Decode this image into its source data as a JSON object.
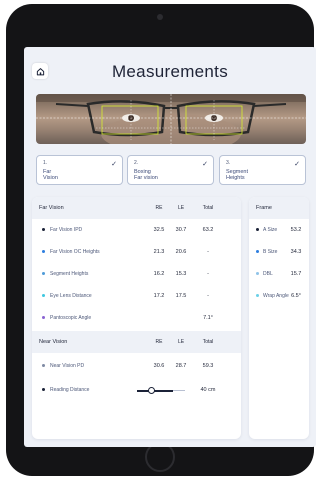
{
  "header": {
    "title": "Measurements",
    "home_icon": "home-icon"
  },
  "steps": [
    {
      "number": "1.",
      "label": "Far\nVision",
      "completed": true
    },
    {
      "number": "2.",
      "label": "Boxing\nFar vision",
      "completed": true
    },
    {
      "number": "3.",
      "label": "Segment\nHeights",
      "completed": true
    }
  ],
  "far_vision": {
    "title": "Far Vision",
    "columns": {
      "re": "RE",
      "le": "LE",
      "total": "Total"
    },
    "rows": [
      {
        "label": "Far Vision IPD",
        "re": "32.5",
        "le": "30.7",
        "total": "63.2",
        "color": "#1b2238"
      },
      {
        "label": "Far Vision OC Heights",
        "re": "21.3",
        "le": "20.6",
        "total": "-",
        "color": "#2d7fe0"
      },
      {
        "label": "Segment Heights",
        "re": "16.2",
        "le": "15.3",
        "total": "-",
        "color": "#4f9bd8"
      },
      {
        "label": "Eye Lens Distance",
        "re": "17.2",
        "le": "17.5",
        "total": "-",
        "color": "#3fc7e0"
      },
      {
        "label": "Pantoscopic Angle",
        "re": "",
        "le": "",
        "total": "7.1°",
        "color": "#8a63d2"
      }
    ]
  },
  "near_vision": {
    "title": "Near Vision",
    "columns": {
      "re": "RE",
      "le": "LE",
      "total": "Total"
    },
    "rows": [
      {
        "label": "Near Vision PD",
        "re": "30.6",
        "le": "28.7",
        "total": "59.3",
        "color": "#7f8aa3"
      },
      {
        "label": "Reading Distance",
        "total": "40 cm",
        "color": "#1b2238"
      }
    ]
  },
  "frame": {
    "title": "Frame",
    "rows": [
      {
        "label": "A Size",
        "value": "53.2",
        "color": "#1b2238"
      },
      {
        "label": "B Size",
        "value": "34.3",
        "color": "#2d7fe0"
      },
      {
        "label": "DBL",
        "value": "15.7",
        "color": "#8fc3e8"
      },
      {
        "label": "Wrap Angle",
        "value": "6.5°",
        "color": "#6bd0e8"
      }
    ]
  }
}
